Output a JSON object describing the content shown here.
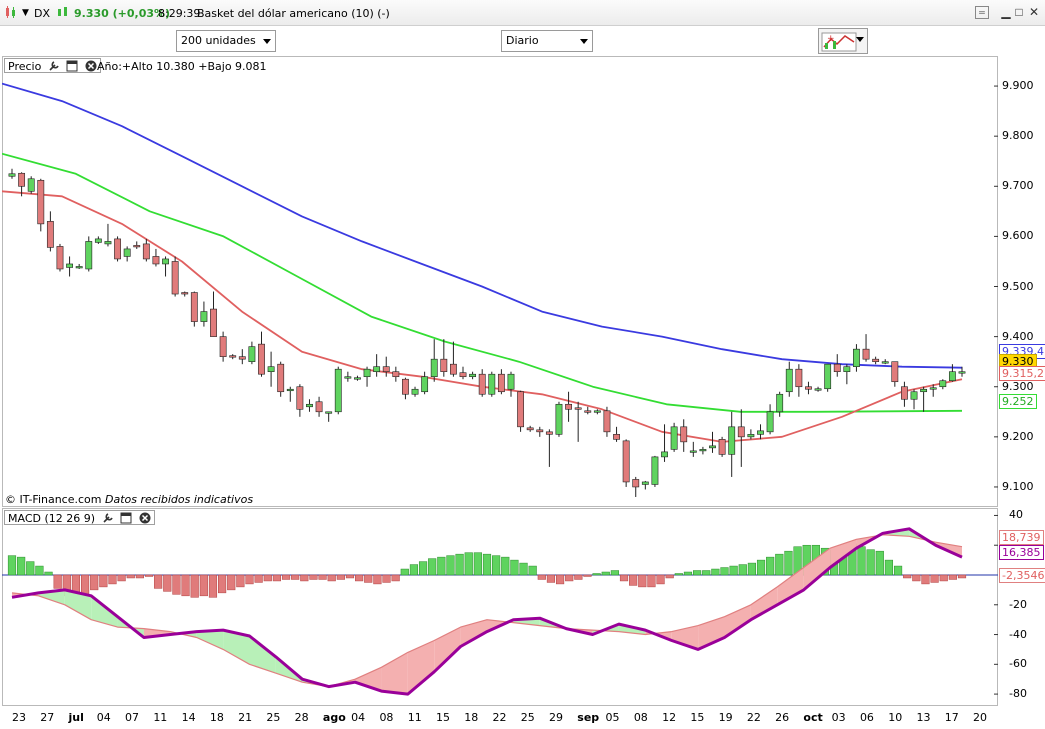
{
  "window": {
    "symbol": "DX",
    "price_change": "9.330 (+0,03%)",
    "time": "8:29:39",
    "description": "Basket del dólar americano (10) (-)",
    "minimize": "▁",
    "restore": "□",
    "close": "✕"
  },
  "toolbar": {
    "units": "200 unidades",
    "period": "Diario"
  },
  "price_pane": {
    "label": "Precio",
    "stats": "Año:+Alto 10.380 +Bajo 9.081",
    "copyright": "© IT-Finance.com",
    "disclaimer": "Datos recibidos indicativos",
    "tag_blue": "9.339,4",
    "tag_last": "9.330",
    "tag_red": "9.315,2",
    "tag_green": "9.252"
  },
  "macd_pane": {
    "label": "MACD (12 26 9)",
    "tag_signal": "18,739",
    "tag_macd": "16,385",
    "tag_hist": "-2,3546"
  },
  "colors": {
    "up": "#5fd35f",
    "down": "#e07b7b",
    "ma_blue": "#3a3ae0",
    "ma_green": "#33dd33",
    "ma_red": "#e06060",
    "macd": "#990099",
    "signal": "#e08080",
    "last_bg": "#ffd700"
  },
  "chart_data": {
    "type": "candlestick",
    "x_ticks": [
      "23",
      "27",
      "jul",
      "04",
      "07",
      "11",
      "14",
      "18",
      "21",
      "25",
      "28",
      "ago",
      "04",
      "08",
      "11",
      "15",
      "18",
      "22",
      "25",
      "29",
      "sep",
      "05",
      "08",
      "12",
      "15",
      "19",
      "22",
      "26",
      "oct",
      "03",
      "06",
      "10",
      "13",
      "17",
      "20"
    ],
    "y_ticks": [
      9.1,
      9.2,
      9.3,
      9.4,
      9.5,
      9.6,
      9.7,
      9.8,
      9.9
    ],
    "y_tick_labels": [
      "9.100",
      "9.200",
      "9.300",
      "9.400",
      "9.500",
      "9.600",
      "9.700",
      "9.800",
      "9.900"
    ],
    "ylim": [
      9.06,
      9.96
    ],
    "candles": [
      [
        9.72,
        9.735,
        9.715,
        9.725
      ],
      [
        9.726,
        9.728,
        9.68,
        9.7
      ],
      [
        9.69,
        9.72,
        9.685,
        9.715
      ],
      [
        9.712,
        9.715,
        9.61,
        9.625
      ],
      [
        9.63,
        9.65,
        9.57,
        9.578
      ],
      [
        9.58,
        9.585,
        9.53,
        9.535
      ],
      [
        9.538,
        9.56,
        9.52,
        9.545
      ],
      [
        9.54,
        9.545,
        9.535,
        9.54
      ],
      [
        9.535,
        9.6,
        9.53,
        9.59
      ],
      [
        9.588,
        9.6,
        9.585,
        9.595
      ],
      [
        9.585,
        9.625,
        9.58,
        9.59
      ],
      [
        9.595,
        9.6,
        9.55,
        9.555
      ],
      [
        9.56,
        9.58,
        9.55,
        9.575
      ],
      [
        9.582,
        9.59,
        9.575,
        9.58
      ],
      [
        9.585,
        9.595,
        9.55,
        9.555
      ],
      [
        9.56,
        9.575,
        9.54,
        9.545
      ],
      [
        9.545,
        9.56,
        9.52,
        9.555
      ],
      [
        9.55,
        9.56,
        9.48,
        9.485
      ],
      [
        9.488,
        9.49,
        9.48,
        9.485
      ],
      [
        9.488,
        9.49,
        9.42,
        9.43
      ],
      [
        9.43,
        9.47,
        9.42,
        9.45
      ],
      [
        9.455,
        9.49,
        9.4,
        9.4
      ],
      [
        9.4,
        9.41,
        9.35,
        9.36
      ],
      [
        9.362,
        9.365,
        9.355,
        9.36
      ],
      [
        9.36,
        9.375,
        9.345,
        9.355
      ],
      [
        9.35,
        9.39,
        9.345,
        9.38
      ],
      [
        9.385,
        9.41,
        9.32,
        9.325
      ],
      [
        9.33,
        9.37,
        9.3,
        9.34
      ],
      [
        9.345,
        9.35,
        9.28,
        9.29
      ],
      [
        9.295,
        9.3,
        9.27,
        9.295
      ],
      [
        9.3,
        9.305,
        9.24,
        9.255
      ],
      [
        9.26,
        9.275,
        9.25,
        9.265
      ],
      [
        9.27,
        9.28,
        9.24,
        9.25
      ],
      [
        9.25,
        9.25,
        9.23,
        9.25
      ],
      [
        9.25,
        9.34,
        9.245,
        9.335
      ],
      [
        9.32,
        9.33,
        9.31,
        9.32
      ],
      [
        9.318,
        9.322,
        9.312,
        9.318
      ],
      [
        9.32,
        9.34,
        9.3,
        9.335
      ],
      [
        9.33,
        9.365,
        9.32,
        9.34
      ],
      [
        9.34,
        9.36,
        9.32,
        9.33
      ],
      [
        9.33,
        9.34,
        9.31,
        9.32
      ],
      [
        9.315,
        9.318,
        9.275,
        9.285
      ],
      [
        9.285,
        9.3,
        9.28,
        9.295
      ],
      [
        9.29,
        9.33,
        9.285,
        9.32
      ],
      [
        9.32,
        9.395,
        9.31,
        9.355
      ],
      [
        9.355,
        9.395,
        9.32,
        9.33
      ],
      [
        9.345,
        9.39,
        9.32,
        9.325
      ],
      [
        9.328,
        9.34,
        9.315,
        9.32
      ],
      [
        9.32,
        9.33,
        9.315,
        9.325
      ],
      [
        9.325,
        9.335,
        9.28,
        9.285
      ],
      [
        9.285,
        9.33,
        9.28,
        9.325
      ],
      [
        9.325,
        9.335,
        9.285,
        9.29
      ],
      [
        9.295,
        9.33,
        9.28,
        9.325
      ],
      [
        9.29,
        9.292,
        9.21,
        9.22
      ],
      [
        9.218,
        9.222,
        9.21,
        9.214
      ],
      [
        9.214,
        9.22,
        9.2,
        9.21
      ],
      [
        9.21,
        9.215,
        9.14,
        9.205
      ],
      [
        9.205,
        9.27,
        9.2,
        9.265
      ],
      [
        9.265,
        9.29,
        9.23,
        9.255
      ],
      [
        9.258,
        9.27,
        9.19,
        9.255
      ],
      [
        9.252,
        9.26,
        9.245,
        9.25
      ],
      [
        9.25,
        9.255,
        9.245,
        9.252
      ],
      [
        9.252,
        9.26,
        9.2,
        9.21
      ],
      [
        9.205,
        9.22,
        9.19,
        9.195
      ],
      [
        9.192,
        9.195,
        9.1,
        9.11
      ],
      [
        9.115,
        9.12,
        9.08,
        9.1
      ],
      [
        9.105,
        9.112,
        9.095,
        9.11
      ],
      [
        9.105,
        9.162,
        9.1,
        9.16
      ],
      [
        9.16,
        9.225,
        9.15,
        9.17
      ],
      [
        9.175,
        9.228,
        9.17,
        9.22
      ],
      [
        9.22,
        9.235,
        9.17,
        9.19
      ],
      [
        9.17,
        9.19,
        9.16,
        9.172
      ],
      [
        9.175,
        9.18,
        9.165,
        9.175
      ],
      [
        9.178,
        9.21,
        9.168,
        9.182
      ],
      [
        9.195,
        9.2,
        9.16,
        9.165
      ],
      [
        9.165,
        9.25,
        9.12,
        9.22
      ],
      [
        9.22,
        9.255,
        9.14,
        9.2
      ],
      [
        9.2,
        9.215,
        9.195,
        9.205
      ],
      [
        9.205,
        9.225,
        9.195,
        9.212
      ],
      [
        9.21,
        9.265,
        9.205,
        9.25
      ],
      [
        9.25,
        9.29,
        9.24,
        9.285
      ],
      [
        9.29,
        9.35,
        9.28,
        9.335
      ],
      [
        9.335,
        9.345,
        9.28,
        9.3
      ],
      [
        9.3,
        9.31,
        9.285,
        9.295
      ],
      [
        9.295,
        9.3,
        9.29,
        9.296
      ],
      [
        9.296,
        9.345,
        9.29,
        9.345
      ],
      [
        9.345,
        9.365,
        9.32,
        9.33
      ],
      [
        9.33,
        9.345,
        9.305,
        9.34
      ],
      [
        9.34,
        9.385,
        9.33,
        9.375
      ],
      [
        9.375,
        9.405,
        9.35,
        9.355
      ],
      [
        9.355,
        9.36,
        9.345,
        9.35
      ],
      [
        9.35,
        9.355,
        9.345,
        9.35
      ],
      [
        9.35,
        9.35,
        9.3,
        9.31
      ],
      [
        9.3,
        9.31,
        9.26,
        9.275
      ],
      [
        9.275,
        9.295,
        9.255,
        9.29
      ],
      [
        9.29,
        9.3,
        9.25,
        9.295
      ],
      [
        9.295,
        9.305,
        9.28,
        9.298
      ],
      [
        9.3,
        9.315,
        9.295,
        9.312
      ],
      [
        9.312,
        9.345,
        9.31,
        9.33
      ],
      [
        9.33,
        9.34,
        9.32,
        9.33
      ]
    ],
    "ma_blue": [
      9.905,
      9.87,
      9.82,
      9.76,
      9.7,
      9.64,
      9.59,
      9.545,
      9.5,
      9.45,
      9.42,
      9.4,
      9.375,
      9.355,
      9.345,
      9.34,
      9.338
    ],
    "ma_green": [
      9.765,
      9.725,
      9.65,
      9.6,
      9.52,
      9.44,
      9.39,
      9.35,
      9.3,
      9.265,
      9.25,
      9.25,
      9.251,
      9.252
    ],
    "ma_red": [
      9.69,
      9.68,
      9.625,
      9.55,
      9.45,
      9.37,
      9.335,
      9.32,
      9.3,
      9.285,
      9.255,
      9.21,
      9.19,
      9.2,
      9.24,
      9.29,
      9.315
    ],
    "macd_yticks": [
      40,
      20,
      0,
      -20,
      -40,
      -60,
      -80
    ],
    "macd_ylim": [
      -88,
      45
    ],
    "macd_line": [
      -15,
      -12,
      -10,
      -14,
      -28,
      -42,
      -40,
      -38,
      -37,
      -41,
      -55,
      -70,
      -75,
      -72,
      -78,
      -80,
      -65,
      -48,
      -38,
      -30,
      -29,
      -36,
      -40,
      -33,
      -37,
      -44,
      -50,
      -42,
      -30,
      -20,
      -10,
      5,
      18,
      28,
      31,
      20,
      12,
      16
    ],
    "signal_line": [
      -12,
      -14,
      -20,
      -30,
      -35,
      -36,
      -38,
      -42,
      -50,
      -60,
      -66,
      -72,
      -75,
      -70,
      -62,
      -52,
      -44,
      -35,
      -30,
      -32,
      -34,
      -36,
      -37,
      -38,
      -40,
      -38,
      -34,
      -28,
      -20,
      -8,
      5,
      18,
      24,
      27,
      26,
      22,
      19
    ],
    "histogram": [
      13,
      12,
      9,
      6,
      2,
      -9,
      -14,
      -18,
      -16,
      -10,
      -8,
      -6,
      -4,
      -2,
      -2,
      -1,
      -9,
      -11,
      -13,
      -14,
      -15,
      -14,
      -15,
      -12,
      -10,
      -8,
      -6,
      -5,
      -4,
      -4,
      -3,
      -3,
      -4,
      -3,
      -3,
      -4,
      -3,
      -2,
      -4,
      -5,
      -6,
      -5,
      -4,
      4,
      7,
      9,
      11,
      12,
      13,
      14,
      15,
      15,
      14,
      13,
      12,
      10,
      8,
      6,
      -3,
      -5,
      -6,
      -4,
      -3,
      -1,
      1,
      2,
      3,
      -4,
      -7,
      -8,
      -8,
      -6,
      -2,
      1,
      2,
      3,
      3,
      4,
      5,
      6,
      7,
      8,
      10,
      12,
      14,
      16,
      19,
      20,
      20,
      18,
      17,
      20,
      21,
      19,
      17,
      16,
      10,
      6,
      -2,
      -4,
      -6,
      -5,
      -4,
      -3,
      -2
    ]
  }
}
